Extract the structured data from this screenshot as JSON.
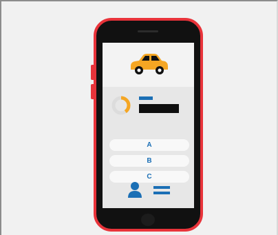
{
  "options": {
    "a_label": "A",
    "b_label": "B",
    "c_label": "C"
  },
  "icons": {
    "car": "taxi-car-icon",
    "progress": "donut-progress-icon",
    "user": "user-avatar-icon"
  },
  "colors": {
    "phone_body": "#111111",
    "phone_border": "#e8333a",
    "accent_orange": "#f5a623",
    "accent_blue": "#1b6fb5",
    "screen_bg": "#f6f6f6"
  },
  "progress": {
    "fraction": 0.4
  }
}
